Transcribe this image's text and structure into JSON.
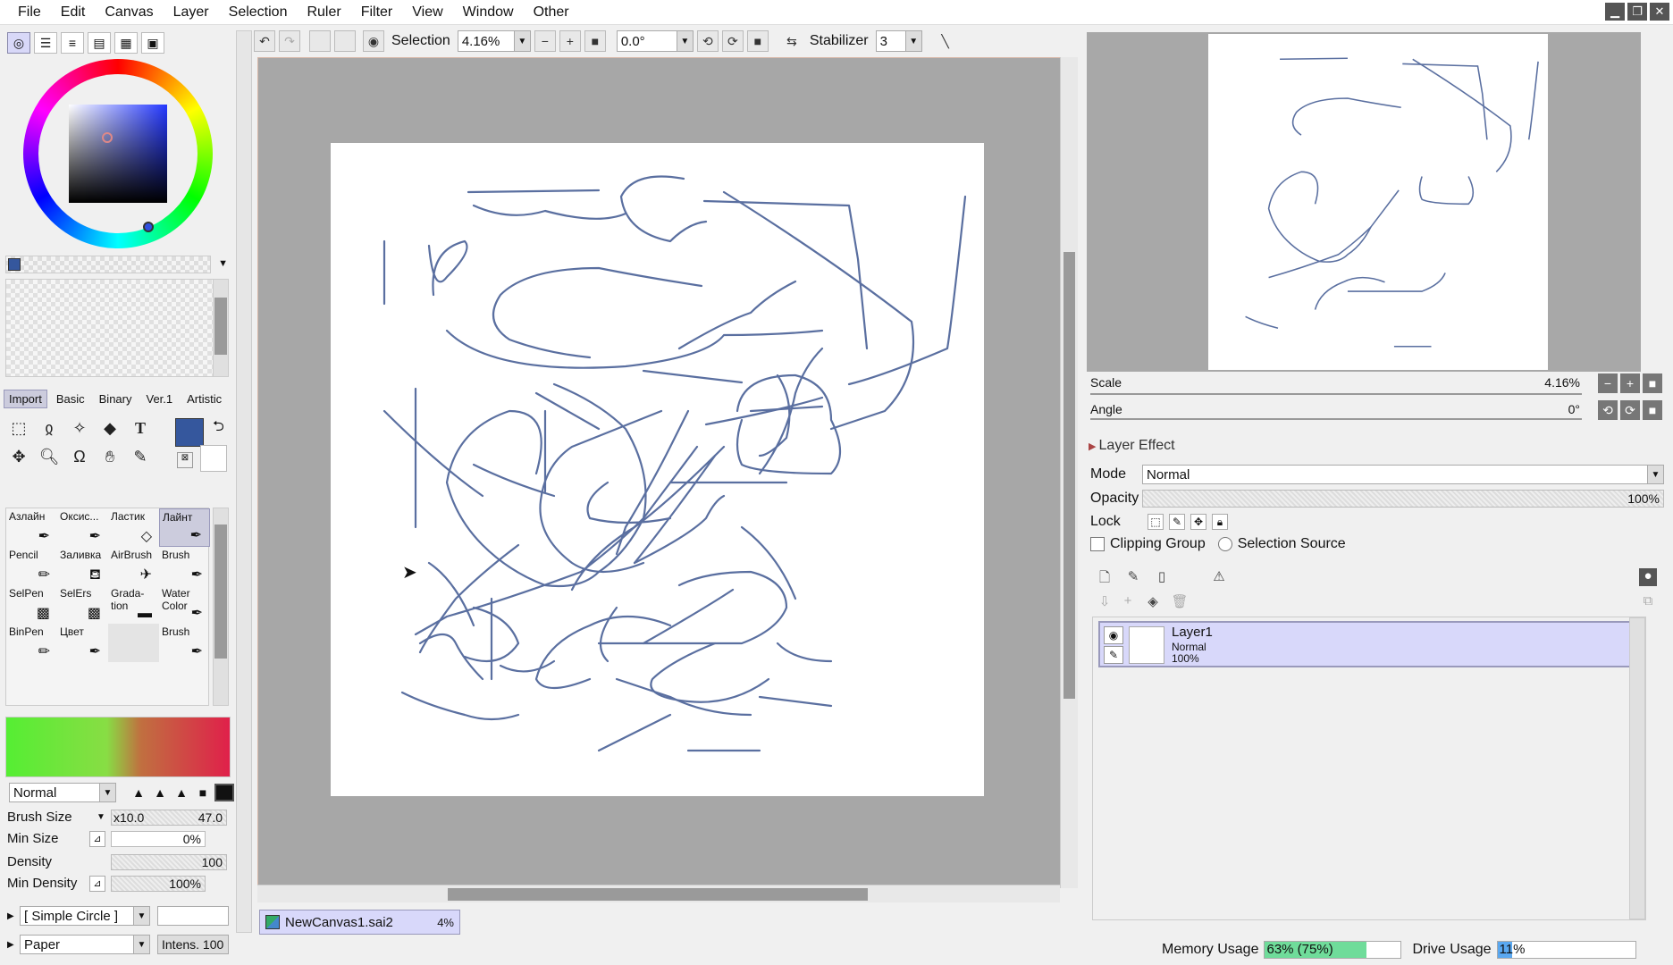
{
  "menu": [
    "File",
    "Edit",
    "Canvas",
    "Layer",
    "Selection",
    "Ruler",
    "Filter",
    "View",
    "Window",
    "Other"
  ],
  "window_controls": [
    "▁",
    "❐",
    "✕"
  ],
  "toolbar": {
    "selection_label": "Selection",
    "zoom": "4.16%",
    "angle": "0.0°",
    "stabilizer_label": "Stabilizer",
    "stabilizer_value": "3"
  },
  "color": {
    "main_hex": "#35579d",
    "sub_hex": "#ffffff"
  },
  "tool_tabs": [
    {
      "label": "Import",
      "active": true
    },
    {
      "label": "Basic",
      "active": false
    },
    {
      "label": "Binary",
      "active": false
    },
    {
      "label": "Ver.1",
      "active": false
    },
    {
      "label": "Artistic",
      "active": false
    }
  ],
  "brushes": [
    {
      "l1": "Азлайн",
      "l2": "",
      "active": false
    },
    {
      "l1": "Оксис...",
      "l2": "",
      "active": false
    },
    {
      "l1": "Ластик",
      "l2": "",
      "active": false
    },
    {
      "l1": "Лайнт",
      "l2": "",
      "active": true
    },
    {
      "l1": "Pencil",
      "l2": "",
      "active": false
    },
    {
      "l1": "Заливка",
      "l2": "",
      "active": false
    },
    {
      "l1": "AirBrush",
      "l2": "",
      "active": false
    },
    {
      "l1": "Brush",
      "l2": "",
      "active": false
    },
    {
      "l1": "SelPen",
      "l2": "",
      "active": false
    },
    {
      "l1": "SelErs",
      "l2": "",
      "active": false
    },
    {
      "l1": "Grada-",
      "l2": "tion",
      "active": false
    },
    {
      "l1": "Water",
      "l2": "Color",
      "active": false
    },
    {
      "l1": "BinPen",
      "l2": "",
      "active": false
    },
    {
      "l1": "Цвет",
      "l2": "",
      "active": false
    },
    {
      "l1": "",
      "l2": "",
      "active": false
    },
    {
      "l1": "Brush",
      "l2": "",
      "active": false
    }
  ],
  "brush_settings": {
    "blend_mode": "Normal",
    "brush_size_label": "Brush Size",
    "brush_size_mult": "x10.0",
    "brush_size_value": "47.0",
    "min_size_label": "Min Size",
    "min_size_value": "0%",
    "density_label": "Density",
    "density_value": "100",
    "min_density_label": "Min Density",
    "min_density_value": "100%",
    "shape": "[ Simple Circle ]",
    "texture": "Paper",
    "intensity": "Intens. 100"
  },
  "document_tab": {
    "name": "NewCanvas1.sai2",
    "zoom": "4%"
  },
  "navigator": {
    "scale_label": "Scale",
    "scale_value": "4.16%",
    "angle_label": "Angle",
    "angle_value": "0°"
  },
  "layer_panel": {
    "layer_effect_label": "Layer Effect",
    "mode_label": "Mode",
    "mode_value": "Normal",
    "opacity_label": "Opacity",
    "opacity_value": "100%",
    "lock_label": "Lock",
    "clipping_label": "Clipping Group",
    "selection_source_label": "Selection Source",
    "layers": [
      {
        "name": "Layer1",
        "mode": "Normal",
        "opacity": "100%"
      }
    ]
  },
  "status": {
    "memory_label": "Memory Usage",
    "memory_value": "63% (75%)",
    "memory_fraction": 0.75,
    "drive_label": "Drive Usage",
    "drive_value": "11%",
    "drive_fraction": 0.11
  }
}
